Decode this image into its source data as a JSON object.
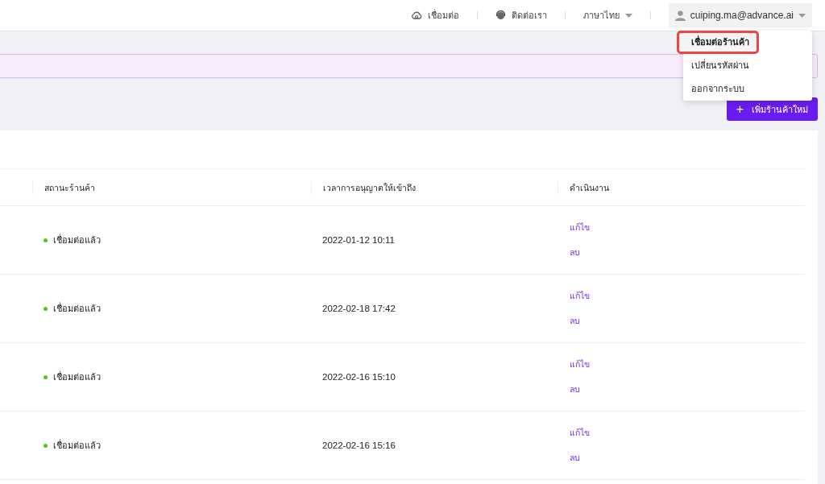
{
  "header": {
    "links": [
      {
        "kind": "cloud",
        "label": "เชื่อมต่อ"
      },
      {
        "kind": "headset",
        "label": "ติดต่อเรา"
      },
      {
        "kind": "dropdown",
        "label": "ภาษาไทย"
      }
    ],
    "user": {
      "label": "cuiping.ma@advance.ai"
    }
  },
  "user_menu": {
    "items": [
      {
        "label": "เชื่อมต่อร้านค้า",
        "selected": true
      },
      {
        "label": "เปลี่ยนรหัสผ่าน",
        "selected": false
      },
      {
        "label": "ออกจากระบบ",
        "selected": false
      }
    ]
  },
  "add_button": {
    "icon": "+",
    "label": "เพิ่มร้านค้าใหม่"
  },
  "table": {
    "columns": [
      "สถานะร้านค้า",
      "เวลาการอนุญาตให้เข้าถึง",
      "ดำเนินงาน"
    ],
    "rows": [
      {
        "status": "เชื่อมต่อแล้ว",
        "time": "2022-01-12 10:11",
        "actions": [
          "แก้ไข",
          "ลบ"
        ]
      },
      {
        "status": "เชื่อมต่อแล้ว",
        "time": "2022-02-18 17:42",
        "actions": [
          "แก้ไข",
          "ลบ"
        ]
      },
      {
        "status": "เชื่อมต่อแล้ว",
        "time": "2022-02-16 15:10",
        "actions": [
          "แก้ไข",
          "ลบ"
        ]
      },
      {
        "status": "เชื่อมต่อแล้ว",
        "time": "2022-02-16 15:16",
        "actions": [
          "แก้ไข",
          "ลบ"
        ]
      }
    ]
  }
}
